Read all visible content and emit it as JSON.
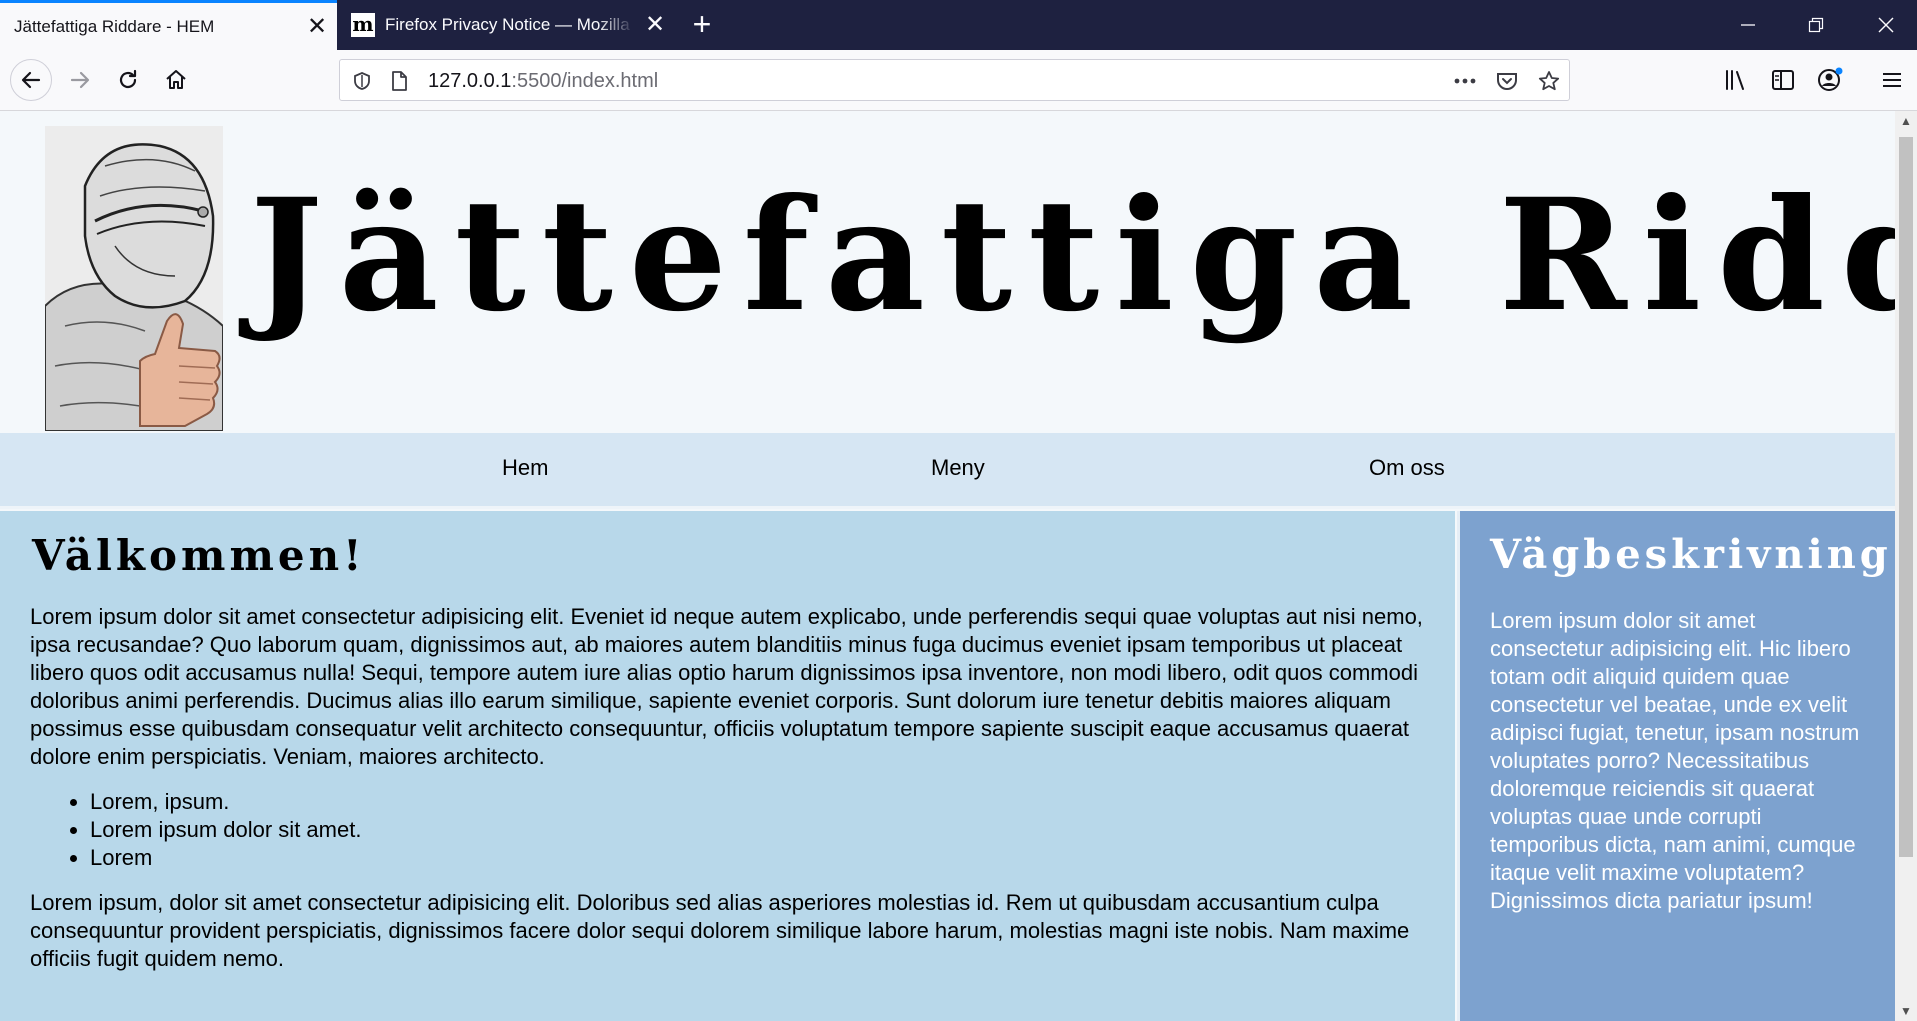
{
  "browser": {
    "tabs": [
      {
        "title": "Jättefattiga Riddare - HEM",
        "active": true
      },
      {
        "title": "Firefox Privacy Notice — Mozilla",
        "active": false,
        "favicon": "m"
      }
    ],
    "new_tab": "+",
    "window": {
      "minimize": "—",
      "restore": "❐",
      "close": "✕"
    },
    "url": {
      "host": "127.0.0.1",
      "path": ":5500/index.html"
    },
    "accent_color": "#0a84ff"
  },
  "site": {
    "title": "Jättefattiga Riddare",
    "nav": [
      "Hem",
      "Meny",
      "Om oss"
    ],
    "main": {
      "heading": "Välkommen!",
      "paragraph1": "Lorem ipsum dolor sit amet consectetur adipisicing elit. Eveniet id neque autem explicabo, unde perferendis sequi quae voluptas aut nisi nemo, ipsa recusandae? Quo laborum quam, dignissimos aut, ab maiores autem blanditiis minus fuga ducimus eveniet ipsam temporibus ut placeat libero quos odit accusamus nulla! Sequi, tempore autem iure alias optio harum dignissimos ipsa inventore, non modi libero, odit quos commodi doloribus animi perferendis. Ducimus alias illo earum similique, sapiente eveniet corporis. Sunt dolorum iure tenetur debitis maiores aliquam possimus esse quibusdam consequatur velit architecto consequuntur, officiis voluptatum tempore sapiente suscipit eaque accusamus quaerat dolore enim perspiciatis. Veniam, maiores architecto.",
      "list": [
        "Lorem, ipsum.",
        "Lorem ipsum dolor sit amet.",
        "Lorem"
      ],
      "paragraph2": "Lorem ipsum, dolor sit amet consectetur adipisicing elit. Doloribus sed alias asperiores molestias id. Rem ut quibusdam accusantium culpa consequuntur provident perspiciatis, dignissimos facere dolor sequi dolorem similique labore harum, molestias magni iste nobis. Nam maxime officiis fugit quidem nemo."
    },
    "sidebar": {
      "heading": "Vägbeskrivning",
      "text": "Lorem ipsum dolor sit amet consectetur adipisicing elit. Hic libero totam odit aliquid quidem quae consectetur vel beatae, unde ex velit adipisci fugiat, tenetur, ipsam nostrum voluptates porro? Necessitatibus doloremque reiciendis sit quaerat voluptas quae unde corrupti temporibus dicta, nam animi, cumque itaque velit maxime voluptatem? Dignissimos dicta pariatur ipsum!"
    },
    "colors": {
      "nav_bg": "#d6e6f3",
      "content_bg": "#b8d8ea",
      "sidebar_bg": "#7da2cf"
    }
  }
}
